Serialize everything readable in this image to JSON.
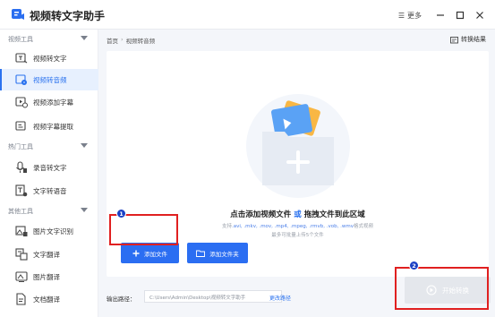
{
  "app": {
    "title": "视频转文字助手"
  },
  "window": {
    "menu_label": "更多"
  },
  "sidebar": {
    "sections": [
      {
        "title": "视频工具",
        "items": [
          {
            "label": "视频转文字",
            "icon": "video-text-icon",
            "active": false
          },
          {
            "label": "视频转音频",
            "icon": "video-audio-icon",
            "active": true
          },
          {
            "label": "视频添加字幕",
            "icon": "add-subtitle-icon",
            "active": false
          },
          {
            "label": "视频字幕提取",
            "icon": "extract-subtitle-icon",
            "active": false
          }
        ]
      },
      {
        "title": "热门工具",
        "items": [
          {
            "label": "录音转文字",
            "icon": "recording-icon",
            "active": false
          },
          {
            "label": "文字转语音",
            "icon": "text-speech-icon",
            "active": false
          }
        ]
      },
      {
        "title": "其他工具",
        "items": [
          {
            "label": "图片文字识别",
            "icon": "image-ocr-icon",
            "active": false
          },
          {
            "label": "文字翻译",
            "icon": "text-translate-icon",
            "active": false
          },
          {
            "label": "图片翻译",
            "icon": "image-translate-icon",
            "active": false
          },
          {
            "label": "文档翻译",
            "icon": "doc-translate-icon",
            "active": false
          }
        ]
      }
    ]
  },
  "main": {
    "breadcrumb": [
      "首页",
      "视频转音频"
    ],
    "breadcrumb_sep": "›",
    "result_link": "转换结果",
    "drop": {
      "title_part1": "点击添加视频文件 ",
      "title_or": "或",
      "title_part2": " 拖拽文件到此区域",
      "formats_prefix": "支持",
      "formats": ".avi, .mkv, .mov, .mp4, .mpeg, .rmvb, .vob, .wmv",
      "formats_suffix": "格式视频",
      "limit": "最多可批量上传5个文件"
    },
    "add_file_label": "添加文件",
    "add_folder_label": "添加文件夹",
    "output_label": "输出路径：",
    "output_path": "C:\\Users\\Admin\\Desktop\\视频转文字助手",
    "change_dir": "更改路径",
    "start_label": "开始转换"
  },
  "annotations": {
    "badge1": "1",
    "badge2": "2"
  },
  "colors": {
    "accent": "#2b6ef2",
    "annotation": "#e02020",
    "badge": "#1a3fc4"
  }
}
